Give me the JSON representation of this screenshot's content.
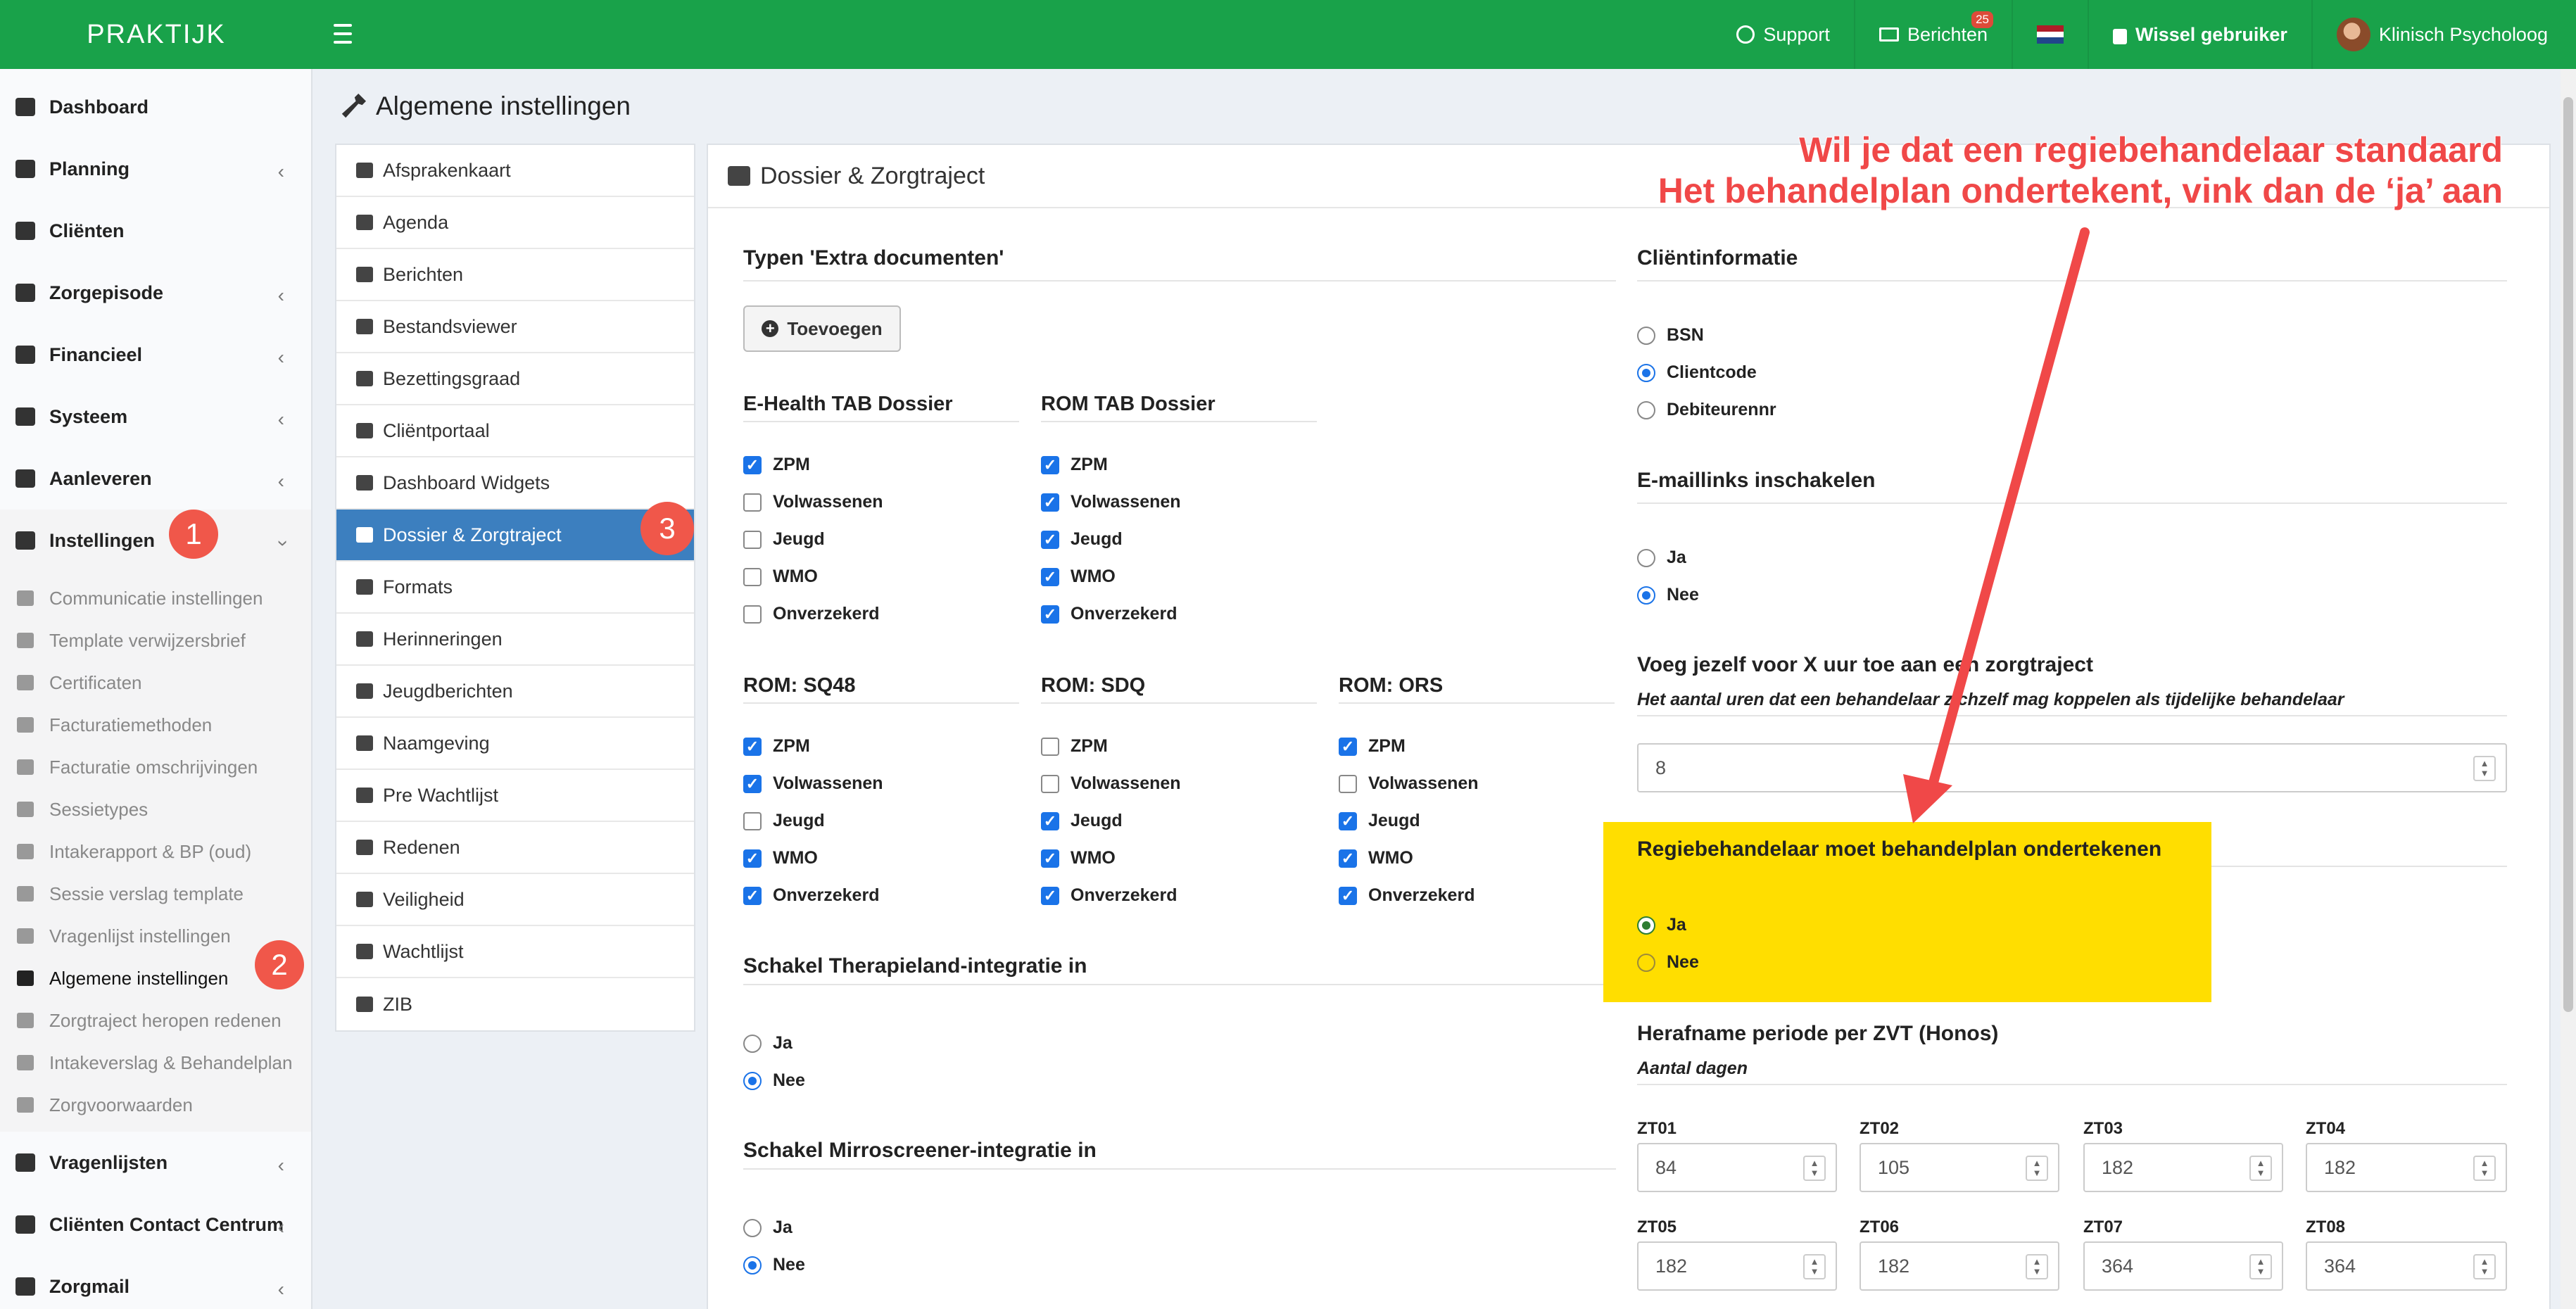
{
  "app": {
    "logo": "PRAKTIJK"
  },
  "topnav": {
    "support": "Support",
    "berichten": "Berichten",
    "berichten_badge": "25",
    "wissel": "Wissel gebruiker",
    "user": "Klinisch Psycholoog"
  },
  "sidebar": {
    "items": [
      {
        "label": "Dashboard"
      },
      {
        "label": "Planning"
      },
      {
        "label": "Cliënten"
      },
      {
        "label": "Zorgepisode"
      },
      {
        "label": "Financieel"
      },
      {
        "label": "Systeem"
      },
      {
        "label": "Aanleveren"
      },
      {
        "label": "Instellingen"
      },
      {
        "label": "Vragenlijsten"
      },
      {
        "label": "Cliënten Contact Centrum"
      },
      {
        "label": "Zorgmail"
      }
    ],
    "sub": [
      "Communicatie instellingen",
      "Template verwijzersbrief",
      "Certificaten",
      "Facturatiemethoden",
      "Facturatie omschrijvingen",
      "Sessietypes",
      "Intakerapport & BP (oud)",
      "Sessie verslag template",
      "Vragenlijst instellingen",
      "Algemene instellingen",
      "Zorgtraject heropen redenen",
      "Intakeverslag & Behandelplan",
      "Zorgvoorwaarden"
    ]
  },
  "page": {
    "title": "Algemene instellingen"
  },
  "settings_menu": [
    "Afsprakenkaart",
    "Agenda",
    "Berichten",
    "Bestandsviewer",
    "Bezettingsgraad",
    "Cliëntportaal",
    "Dashboard Widgets",
    "Dossier & Zorgtraject",
    "Formats",
    "Herinneringen",
    "Jeugdberichten",
    "Naamgeving",
    "Pre Wachtlijst",
    "Redenen",
    "Veiligheid",
    "Wachtlijst",
    "ZIB"
  ],
  "panel": {
    "title": "Dossier & Zorgtraject",
    "extra_docs": {
      "title": "Typen 'Extra documenten'",
      "button": "Toevoegen"
    },
    "ehealth": {
      "title": "E-Health TAB Dossier",
      "options": [
        "ZPM",
        "Volwassenen",
        "Jeugd",
        "WMO",
        "Onverzekerd"
      ],
      "checked": [
        true,
        false,
        false,
        false,
        false
      ]
    },
    "rom_tab": {
      "title": "ROM TAB Dossier",
      "options": [
        "ZPM",
        "Volwassenen",
        "Jeugd",
        "WMO",
        "Onverzekerd"
      ],
      "checked": [
        true,
        true,
        true,
        true,
        true
      ]
    },
    "rom_sq48": {
      "title": "ROM: SQ48",
      "options": [
        "ZPM",
        "Volwassenen",
        "Jeugd",
        "WMO",
        "Onverzekerd"
      ],
      "checked": [
        true,
        true,
        false,
        true,
        true
      ]
    },
    "rom_sdq": {
      "title": "ROM: SDQ",
      "options": [
        "ZPM",
        "Volwassenen",
        "Jeugd",
        "WMO",
        "Onverzekerd"
      ],
      "checked": [
        false,
        false,
        true,
        true,
        true
      ]
    },
    "rom_ors": {
      "title": "ROM: ORS",
      "options": [
        "ZPM",
        "Volwassenen",
        "Jeugd",
        "WMO",
        "Onverzekerd"
      ],
      "checked": [
        true,
        false,
        true,
        true,
        true
      ]
    },
    "therapieland": {
      "title": "Schakel Therapieland-integratie in",
      "ja": "Ja",
      "nee": "Nee",
      "selected": "Nee"
    },
    "mirro": {
      "title": "Schakel Mirroscreener-integratie in",
      "ja": "Ja",
      "nee": "Nee",
      "selected": "Nee"
    },
    "clientinfo": {
      "title": "Cliëntinformatie",
      "options": [
        "BSN",
        "Clientcode",
        "Debiteurennr"
      ],
      "selected": "Clientcode"
    },
    "emaillinks": {
      "title": "E-maillinks inschakelen",
      "ja": "Ja",
      "nee": "Nee",
      "selected": "Nee"
    },
    "voeg": {
      "title": "Voeg jezelf voor X uur toe aan een zorgtraject",
      "sub": "Het aantal uren dat een behandelaar zichzelf mag koppelen als tijdelijke behandelaar",
      "value": "8"
    },
    "regie": {
      "title": "Regiebehandelaar moet behandelplan ondertekenen",
      "ja": "Ja",
      "nee": "Nee",
      "selected": "Ja"
    },
    "herafname": {
      "title": "Herafname periode per ZVT (Honos)",
      "sub": "Aantal dagen",
      "fields": [
        {
          "label": "ZT01",
          "value": "84"
        },
        {
          "label": "ZT02",
          "value": "105"
        },
        {
          "label": "ZT03",
          "value": "182"
        },
        {
          "label": "ZT04",
          "value": "182"
        },
        {
          "label": "ZT05",
          "value": "182"
        },
        {
          "label": "ZT06",
          "value": "182"
        },
        {
          "label": "ZT07",
          "value": "364"
        },
        {
          "label": "ZT08",
          "value": "364"
        }
      ]
    }
  },
  "annotation": {
    "line1": "Wil je dat een regiebehandelaar standaard",
    "line2": "Het behandelplan ondertekent, vink dan de ‘ja’ aan",
    "markers": [
      "1",
      "2",
      "3"
    ],
    "color": "#f04848"
  },
  "colors": {
    "topbar": "#19a24a",
    "active_menu": "#3c7fbf",
    "highlight": "#ffde00",
    "checkbox": "#1a73e8"
  }
}
